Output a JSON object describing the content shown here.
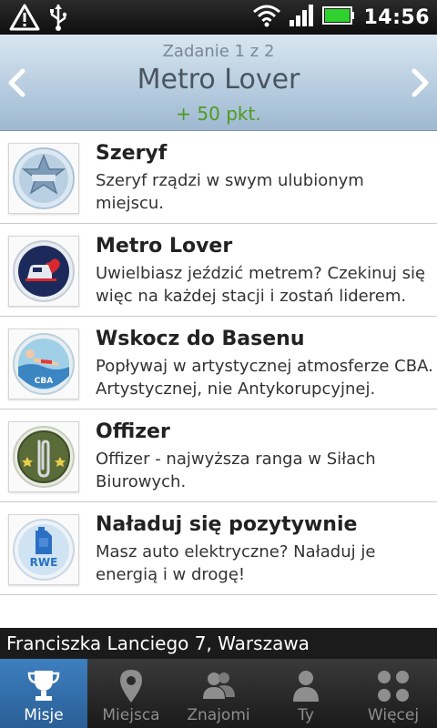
{
  "status_bar": {
    "time": "14:56",
    "icons": [
      "warning-icon",
      "usb-icon",
      "wifi-icon",
      "signal-icon",
      "battery-icon"
    ]
  },
  "header": {
    "subtitle": "Zadanie 1 z 2",
    "title": "Metro Lover",
    "points": "+ 50 pkt."
  },
  "missions": [
    {
      "title": "Szeryf",
      "description": "Szeryf rządzi w swym ulubionym miejscu.",
      "badge": "sheriff-star-badge"
    },
    {
      "title": "Metro Lover",
      "description": "Uwielbiasz jeździć metrem? Czekinuj się więc na każdej stacji i zostań liderem.",
      "badge": "metro-heart-badge"
    },
    {
      "title": "Wskocz do Basenu",
      "description": "Popływaj w artystycznej atmosferze CBA. Artystycznej, nie Antykorupcyjnej.",
      "badge": "swimmer-badge",
      "badge_text": "CBA"
    },
    {
      "title": "Offizer",
      "description": "Offizer - najwyższa ranga w Siłach Biurowych.",
      "badge": "paperclip-badge"
    },
    {
      "title": "Naładuj się pozytywnie",
      "description": "Masz auto elektryczne? Naładuj je energią i w drogę!",
      "badge": "rwe-canister-badge",
      "badge_text": "RWE"
    }
  ],
  "location": "Franciszka Lanciego 7, Warszawa",
  "tabs": [
    {
      "label": "Misje",
      "icon": "trophy-icon",
      "active": true
    },
    {
      "label": "Miejsca",
      "icon": "map-pin-icon",
      "active": false
    },
    {
      "label": "Znajomi",
      "icon": "friends-icon",
      "active": false
    },
    {
      "label": "Ty",
      "icon": "person-icon",
      "active": false
    },
    {
      "label": "Więcej",
      "icon": "grid-dots-icon",
      "active": false
    }
  ],
  "colors": {
    "points_green": "#4e9a1e",
    "active_tab_blue": "#2f6aa6",
    "header_blue": "#b7cde0"
  }
}
